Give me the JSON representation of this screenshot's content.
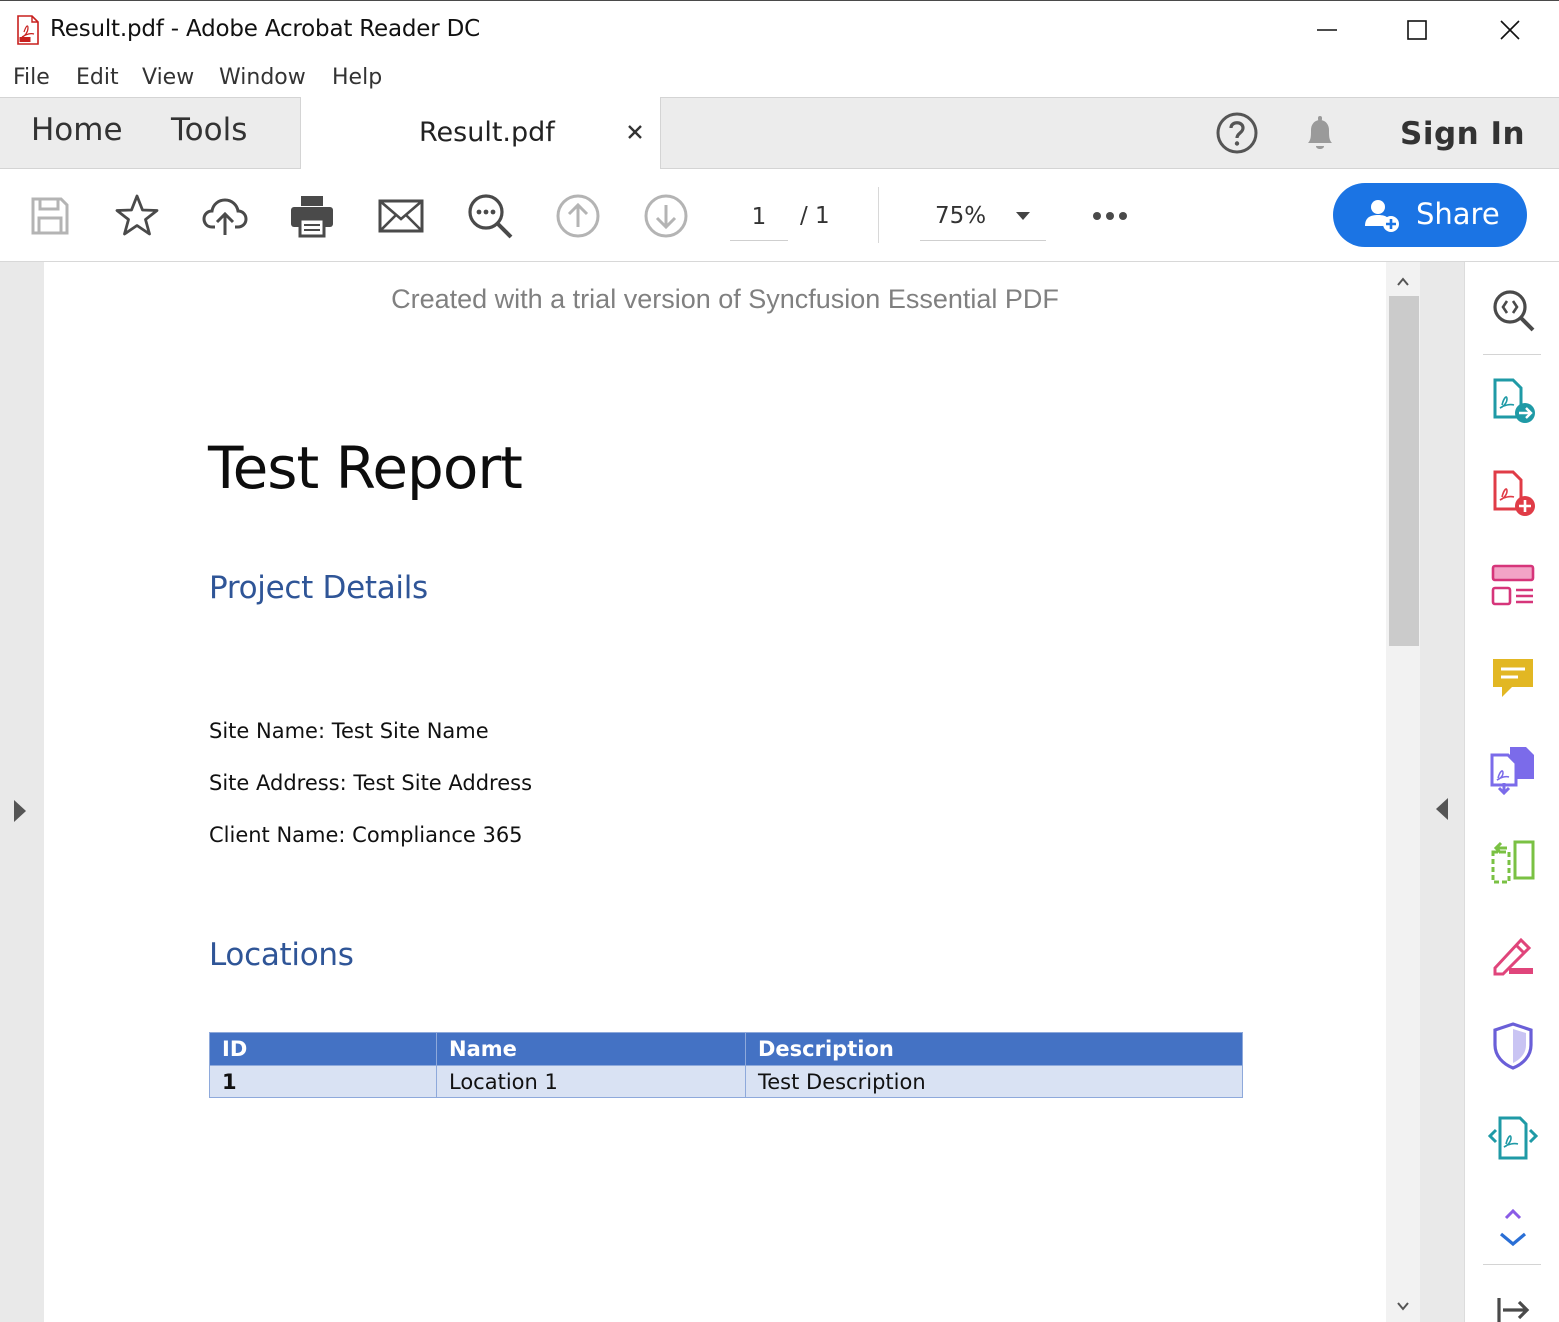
{
  "window": {
    "title": "Result.pdf - Adobe Acrobat Reader DC"
  },
  "menu": [
    "File",
    "Edit",
    "View",
    "Window",
    "Help"
  ],
  "tabs": {
    "home": "Home",
    "tools": "Tools",
    "document": "Result.pdf",
    "sign_in": "Sign In"
  },
  "toolbar": {
    "page_current": "1",
    "page_total": "/ 1",
    "zoom": "75%",
    "share_label": "Share",
    "accent_color": "#1b74e4"
  },
  "document": {
    "watermark": "Created with a trial version of Syncfusion Essential PDF",
    "title": "Test Report",
    "project_heading": "Project Details",
    "site_name": "Site Name: Test Site Name",
    "site_address": "Site Address: Test Site Address",
    "client_name": "Client Name: Compliance 365",
    "locations_heading": "Locations",
    "table": {
      "headers": [
        "ID",
        "Name",
        "Description"
      ],
      "rows": [
        [
          "1",
          "Location 1",
          "Test Description"
        ]
      ]
    }
  },
  "right_panel_icons": [
    "zoom-search-icon",
    "export-pdf-icon",
    "create-pdf-icon",
    "edit-pdf-icon",
    "comment-icon",
    "combine-files-icon",
    "organize-pages-icon",
    "fill-sign-icon",
    "protect-icon",
    "compress-pdf-icon",
    "more-tools-icon",
    "collapse-panel-icon"
  ]
}
